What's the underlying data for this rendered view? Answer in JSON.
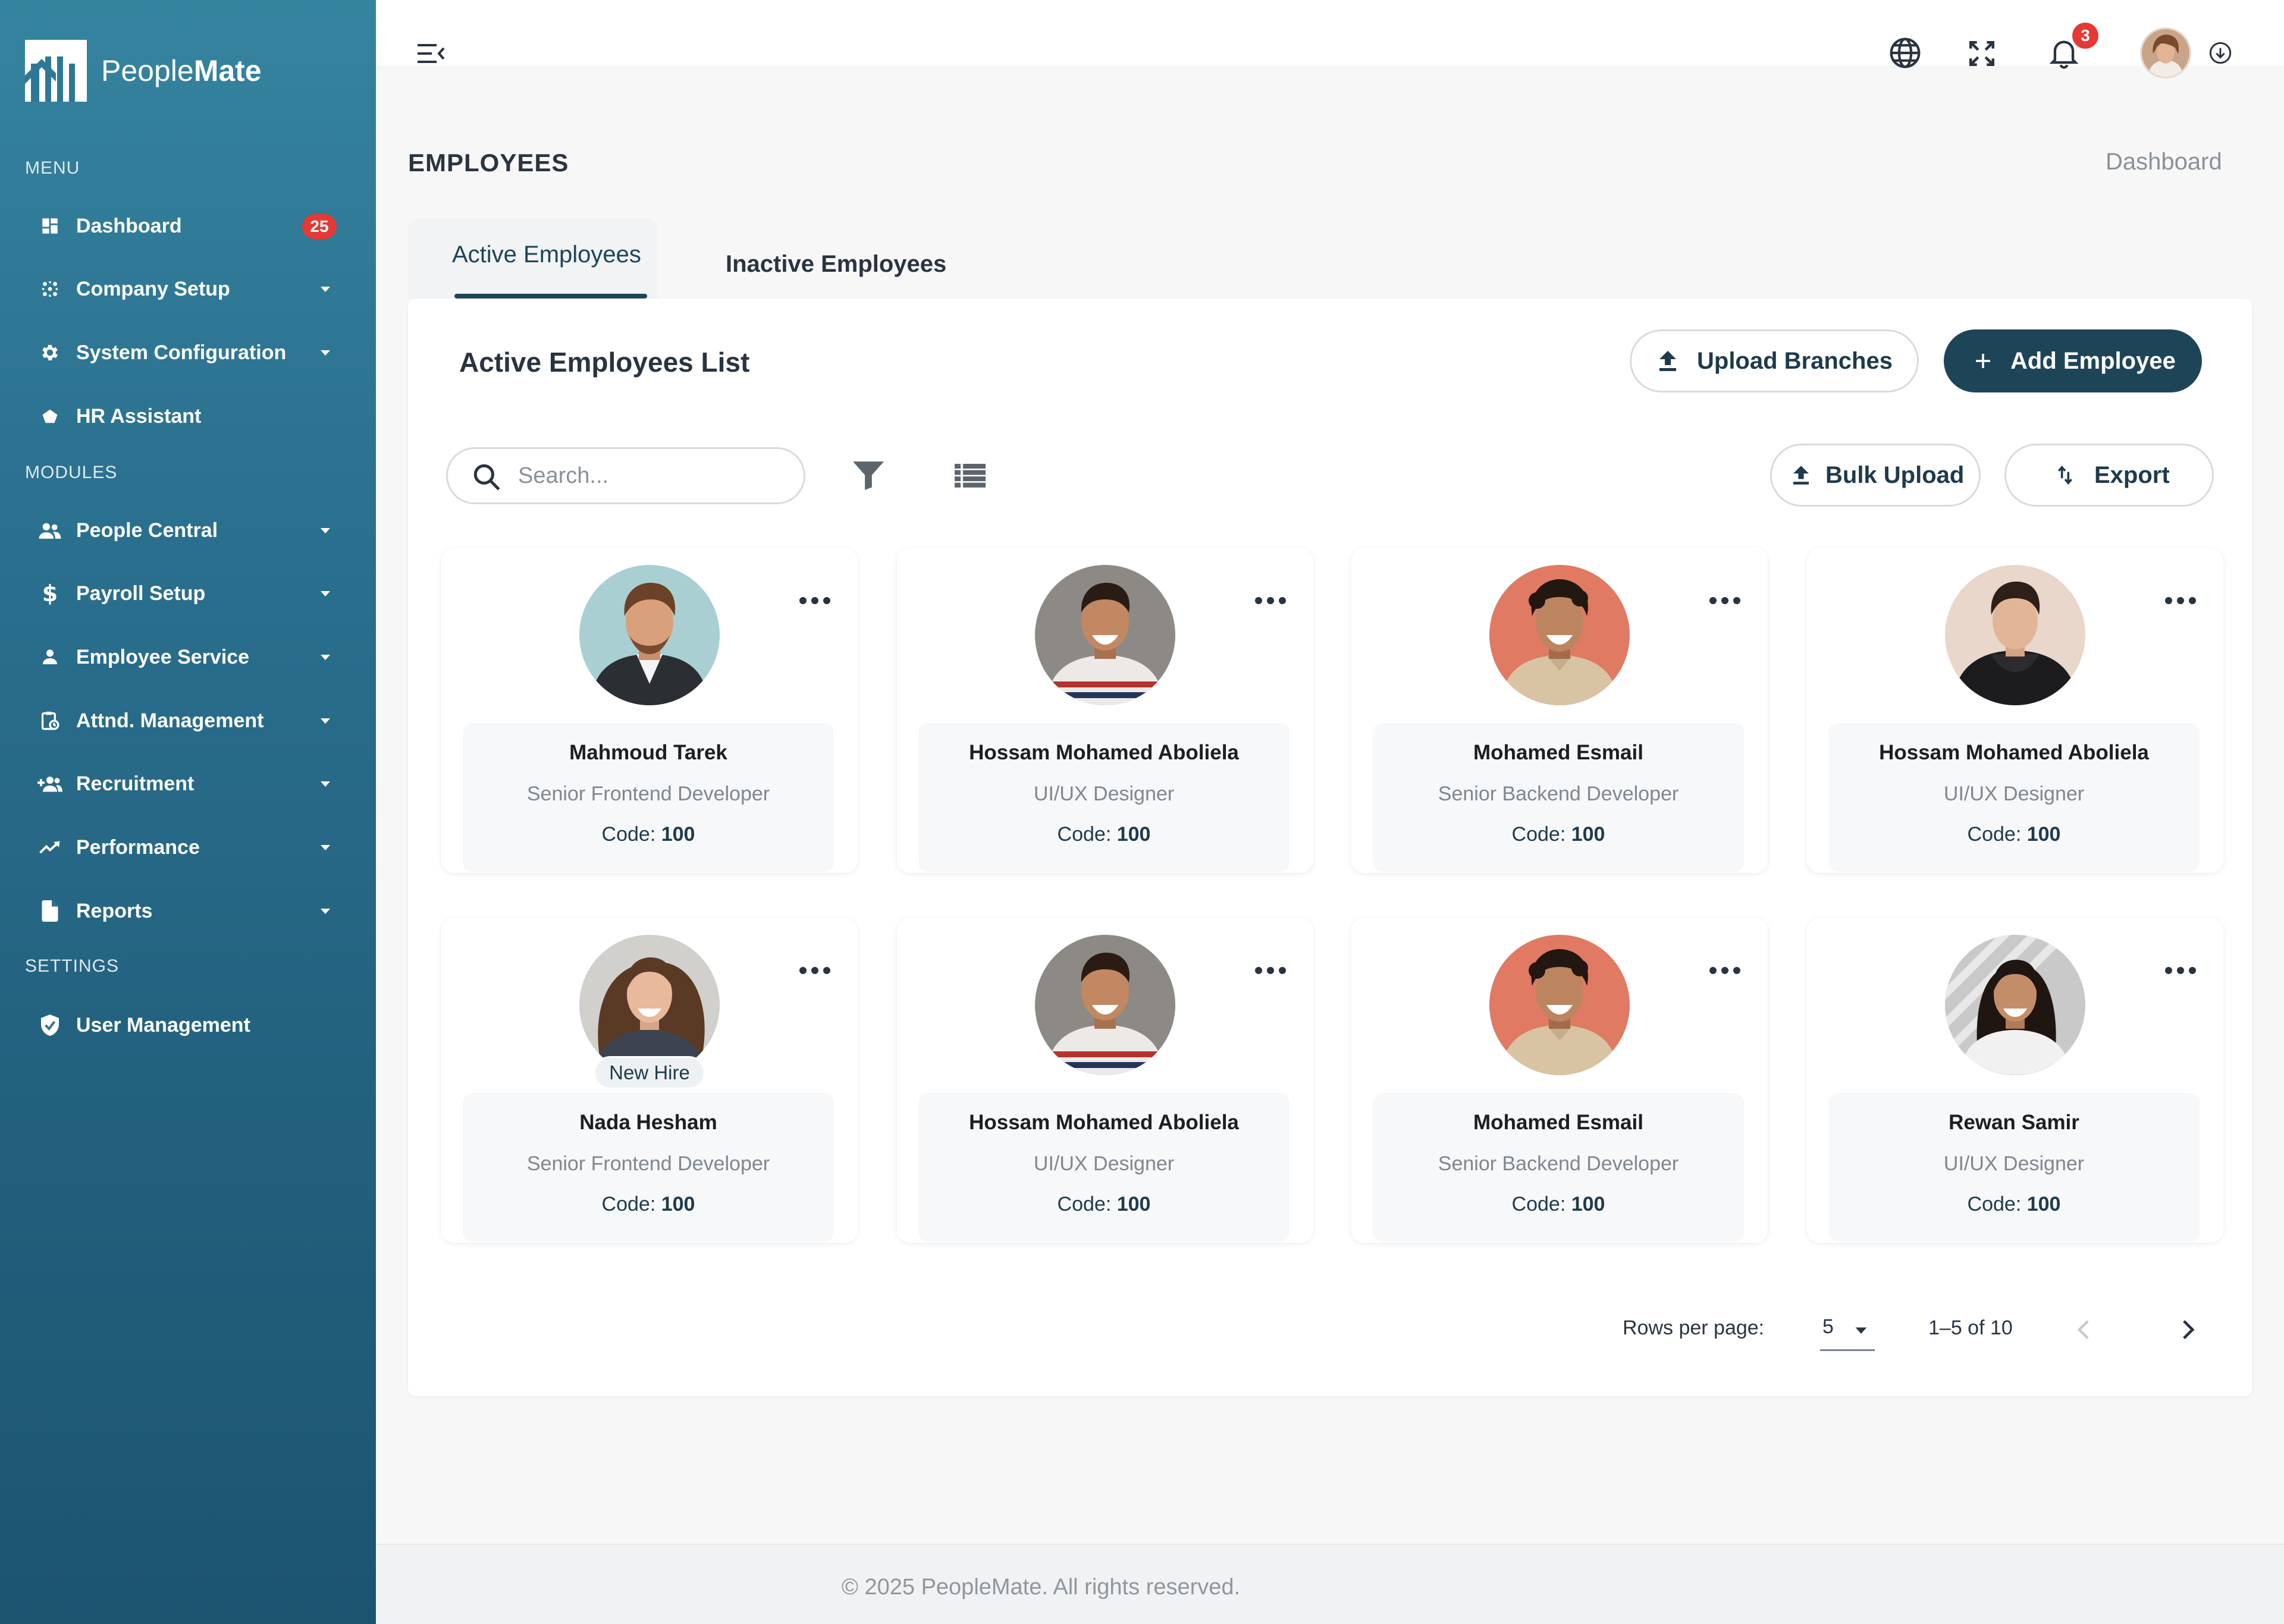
{
  "app": {
    "brand_light": "People",
    "brand_bold": "Mate"
  },
  "sidebar": {
    "menu_label": "MENU",
    "modules_label": "MODULES",
    "settings_label": "SETTINGS",
    "dashboard": {
      "label": "Dashboard",
      "badge": "25"
    },
    "company_setup": "Company Setup",
    "system_configuration": "System Configuration",
    "hr_assistant": "HR Assistant",
    "people_central": "People Central",
    "payroll_setup": "Payroll Setup",
    "employee_service": "Employee Service",
    "attendance": "Attnd. Management",
    "recruitment": "Recruitment",
    "performance": "Performance",
    "reports": "Reports",
    "user_management": "User Management"
  },
  "topbar": {
    "notification_count": "3"
  },
  "page": {
    "title": "EMPLOYEES",
    "breadcrumb": "Dashboard"
  },
  "tabs": {
    "active": "Active Employees",
    "inactive": "Inactive Employees"
  },
  "list": {
    "title": "Active Employees List",
    "upload_branches": "Upload Branches",
    "add_employee": "Add Employee",
    "search_placeholder": "Search...",
    "bulk_upload": "Bulk Upload",
    "export": "Export"
  },
  "employees": [
    {
      "name": "Mahmoud Tarek",
      "role": "Senior Frontend Developer",
      "code_label": "Code:",
      "code": "100"
    },
    {
      "name": "Hossam Mohamed Aboliela",
      "role": "UI/UX Designer",
      "code_label": "Code:",
      "code": "100"
    },
    {
      "name": "Mohamed Esmail",
      "role": "Senior Backend Developer",
      "code_label": "Code:",
      "code": "100"
    },
    {
      "name": "Hossam Mohamed Aboliela",
      "role": "UI/UX Designer",
      "code_label": "Code:",
      "code": "100"
    },
    {
      "name": "Nada Hesham",
      "role": "Senior Frontend Developer",
      "code_label": "Code:",
      "code": "100",
      "badge": "New Hire"
    },
    {
      "name": "Hossam Mohamed Aboliela",
      "role": "UI/UX Designer",
      "code_label": "Code:",
      "code": "100"
    },
    {
      "name": "Mohamed Esmail",
      "role": "Senior Backend Developer",
      "code_label": "Code:",
      "code": "100"
    },
    {
      "name": "Rewan Samir",
      "role": "UI/UX Designer",
      "code_label": "Code:",
      "code": "100"
    }
  ],
  "pagination": {
    "rows_label": "Rows per page:",
    "rows_value": "5",
    "range": "1–5 of 10"
  },
  "footer": {
    "text": "© 2025  PeopleMate. All rights reserved."
  },
  "colors": {
    "sidebar_top": "#35849f",
    "sidebar_bottom": "#1c5470",
    "accent": "#1e4557",
    "badge": "#e53935"
  }
}
